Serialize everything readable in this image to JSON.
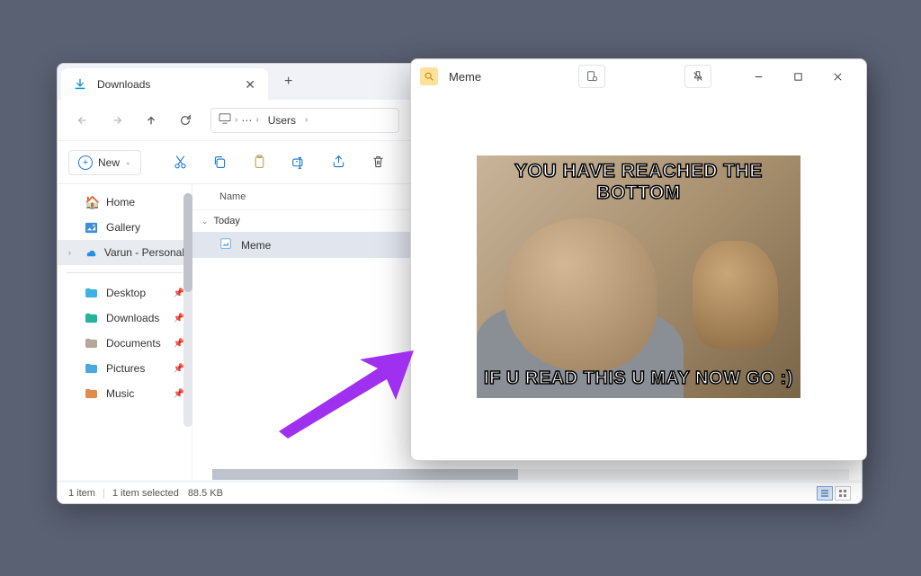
{
  "explorer": {
    "tab": {
      "title": "Downloads"
    },
    "breadcrumb": {
      "segment": "Users"
    },
    "toolbar": {
      "new_label": "New"
    },
    "sidebar": {
      "items": [
        {
          "label": "Home",
          "icon": "home"
        },
        {
          "label": "Gallery",
          "icon": "gallery"
        },
        {
          "label": "Varun - Personal",
          "icon": "onedrive",
          "hasChevron": true,
          "selected": true
        }
      ],
      "quickAccess": [
        {
          "label": "Desktop",
          "pinned": true
        },
        {
          "label": "Downloads",
          "pinned": true
        },
        {
          "label": "Documents",
          "pinned": true
        },
        {
          "label": "Pictures",
          "pinned": true
        },
        {
          "label": "Music",
          "pinned": true
        }
      ]
    },
    "fileList": {
      "columns": [
        "Name"
      ],
      "group": "Today",
      "files": [
        {
          "name": "Meme",
          "selected": true
        }
      ]
    },
    "statusBar": {
      "itemCount": "1 item",
      "selection": "1 item selected",
      "size": "88.5 KB"
    }
  },
  "preview": {
    "title": "Meme",
    "meme": {
      "topText": "YOU HAVE REACHED THE BOTTOM",
      "bottomText": "IF U READ THIS U MAY NOW GO :)"
    }
  },
  "colors": {
    "accent": "#1976d2",
    "selection": "#e1e5ed",
    "arrow": "#a030f0"
  }
}
